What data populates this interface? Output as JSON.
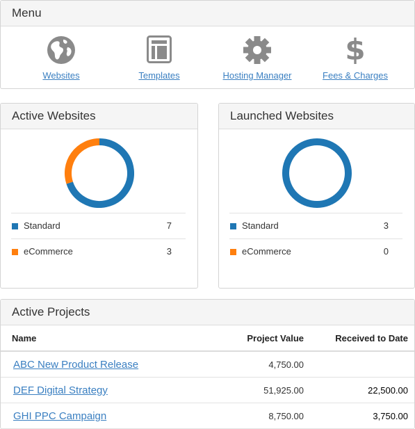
{
  "menu": {
    "title": "Menu",
    "items": [
      {
        "label": "Websites",
        "icon": "globe-icon"
      },
      {
        "label": "Templates",
        "icon": "template-icon"
      },
      {
        "label": "Hosting Manager",
        "icon": "gear-icon"
      },
      {
        "label": "Fees & Charges",
        "icon": "dollar-icon"
      }
    ]
  },
  "active_websites": {
    "title": "Active Websites",
    "items": [
      {
        "label": "Standard",
        "value": "7"
      },
      {
        "label": "eCommerce",
        "value": "3"
      }
    ]
  },
  "launched_websites": {
    "title": "Launched Websites",
    "items": [
      {
        "label": "Standard",
        "value": "3"
      },
      {
        "label": "eCommerce",
        "value": "0"
      }
    ]
  },
  "colors": {
    "standard": "#1f77b4",
    "ecommerce": "#ff7f0e",
    "link": "#3a7fc1",
    "icon": "#8a8a8a"
  },
  "chart_data": [
    {
      "type": "pie",
      "categories": [
        "Standard",
        "eCommerce"
      ],
      "values": [
        7,
        3
      ]
    },
    {
      "type": "pie",
      "categories": [
        "Standard",
        "eCommerce"
      ],
      "values": [
        3,
        0
      ]
    }
  ],
  "projects": {
    "title": "Active Projects",
    "headers": {
      "name": "Name",
      "value": "Project Value",
      "received": "Received to Date"
    },
    "rows": [
      {
        "name": "ABC New Product Release",
        "value": "4,750.00",
        "received": ""
      },
      {
        "name": "DEF Digital Strategy",
        "value": "51,925.00",
        "received": "22,500.00"
      },
      {
        "name": "GHI PPC Campaign",
        "value": "8,750.00",
        "received": "3,750.00"
      }
    ]
  }
}
